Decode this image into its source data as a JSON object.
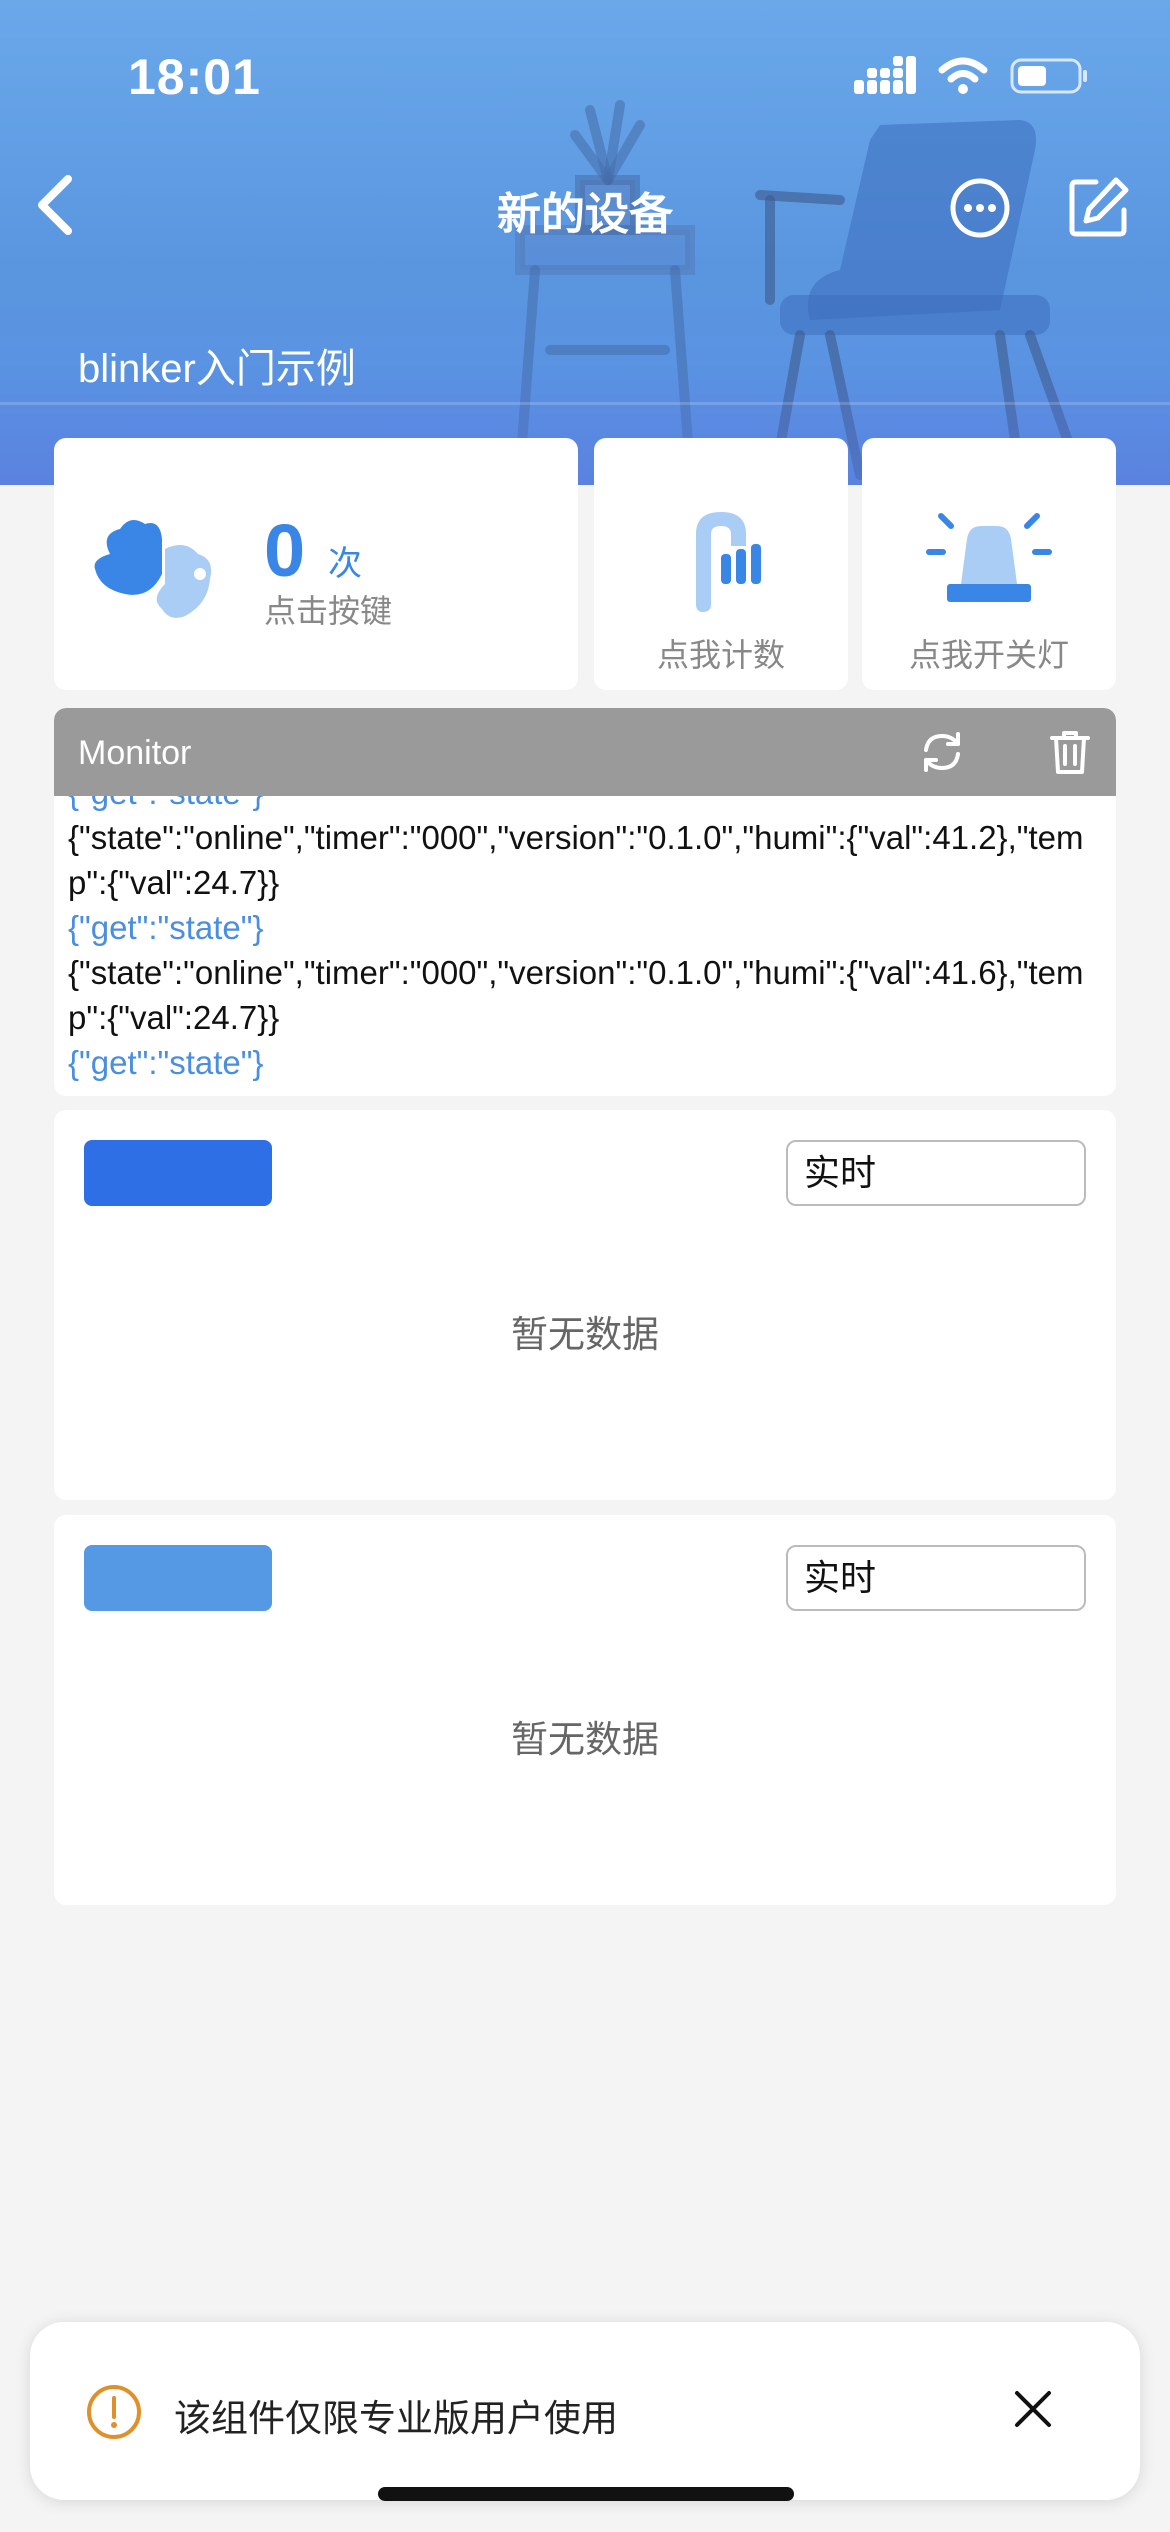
{
  "status_bar": {
    "time": "18:01"
  },
  "nav": {
    "title": "新的设备",
    "subtitle": "blinker入门示例"
  },
  "counter": {
    "value": "0",
    "unit": "次",
    "label": "点击按键"
  },
  "buttons": [
    {
      "label": "点我计数",
      "icon": "tap-count-icon"
    },
    {
      "label": "点我开关灯",
      "icon": "alarm-light-icon"
    }
  ],
  "monitor": {
    "title": "Monitor",
    "lines": [
      {
        "kind": "req",
        "text": "{\"get\":\"state\"}"
      },
      {
        "kind": "resp",
        "text": "{\"state\":\"online\",\"timer\":\"000\",\"version\":\"0.1.0\",\"humi\":{\"val\":41.2},\"temp\":{\"val\":24.7}}"
      },
      {
        "kind": "req",
        "text": "{\"get\":\"state\"}"
      },
      {
        "kind": "resp",
        "text": "{\"state\":\"online\",\"timer\":\"000\",\"version\":\"0.1.0\",\"humi\":{\"val\":41.6},\"temp\":{\"val\":24.7}}"
      },
      {
        "kind": "req",
        "text": "{\"get\":\"state\"}"
      }
    ]
  },
  "charts": [
    {
      "button_color": "#2f6fe6",
      "select_value": "实时",
      "empty_text": "暂无数据"
    },
    {
      "button_color": "#5598e4",
      "select_value": "实时",
      "empty_text": "暂无数据"
    }
  ],
  "toast": {
    "text": "该组件仅限专业版用户使用"
  },
  "colors": {
    "accent": "#3a86e6",
    "warning": "#e0902a"
  }
}
